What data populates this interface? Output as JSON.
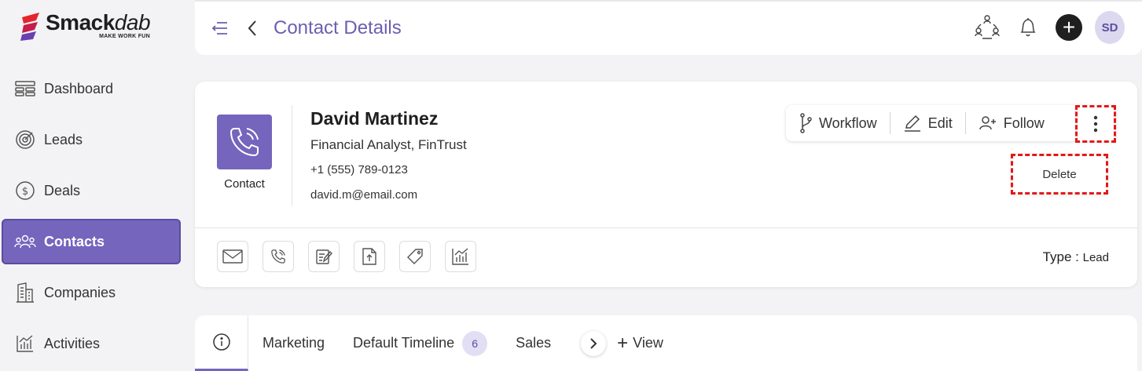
{
  "brand": {
    "name_bold": "Smack",
    "name_italic": "dab",
    "tagline": "MAKE WORK FUN",
    "color": "#e3262e"
  },
  "sidebar": {
    "items": [
      {
        "label": "Dashboard",
        "icon": "dashboard-icon",
        "active": false
      },
      {
        "label": "Leads",
        "icon": "target-icon",
        "active": false
      },
      {
        "label": "Deals",
        "icon": "dollar-icon",
        "active": false
      },
      {
        "label": "Contacts",
        "icon": "people-icon",
        "active": true
      },
      {
        "label": "Companies",
        "icon": "building-icon",
        "active": false
      },
      {
        "label": "Activities",
        "icon": "activity-chart-icon",
        "active": false
      }
    ],
    "active_color": "#7565bd"
  },
  "header": {
    "title": "Contact Details",
    "avatar_initials": "SD",
    "plus_label": "+"
  },
  "contact": {
    "badge_label": "Contact",
    "name": "David Martinez",
    "job": "Financial Analyst, FinTrust",
    "phone": "+1 (555) 789-0123",
    "email": "david.m@email.com",
    "type_label": "Type :",
    "type_value": "Lead"
  },
  "actions": {
    "workflow": "Workflow",
    "edit": "Edit",
    "follow": "Follow",
    "delete": "Delete"
  },
  "tools": [
    "email-icon",
    "phone-icon",
    "note-icon",
    "upload-icon",
    "tag-icon",
    "activity-icon"
  ],
  "tabs": {
    "items": [
      {
        "label": "Marketing"
      },
      {
        "label": "Default Timeline",
        "count": "6"
      },
      {
        "label": "Sales"
      }
    ],
    "view_label": "View",
    "view_plus": "+"
  }
}
